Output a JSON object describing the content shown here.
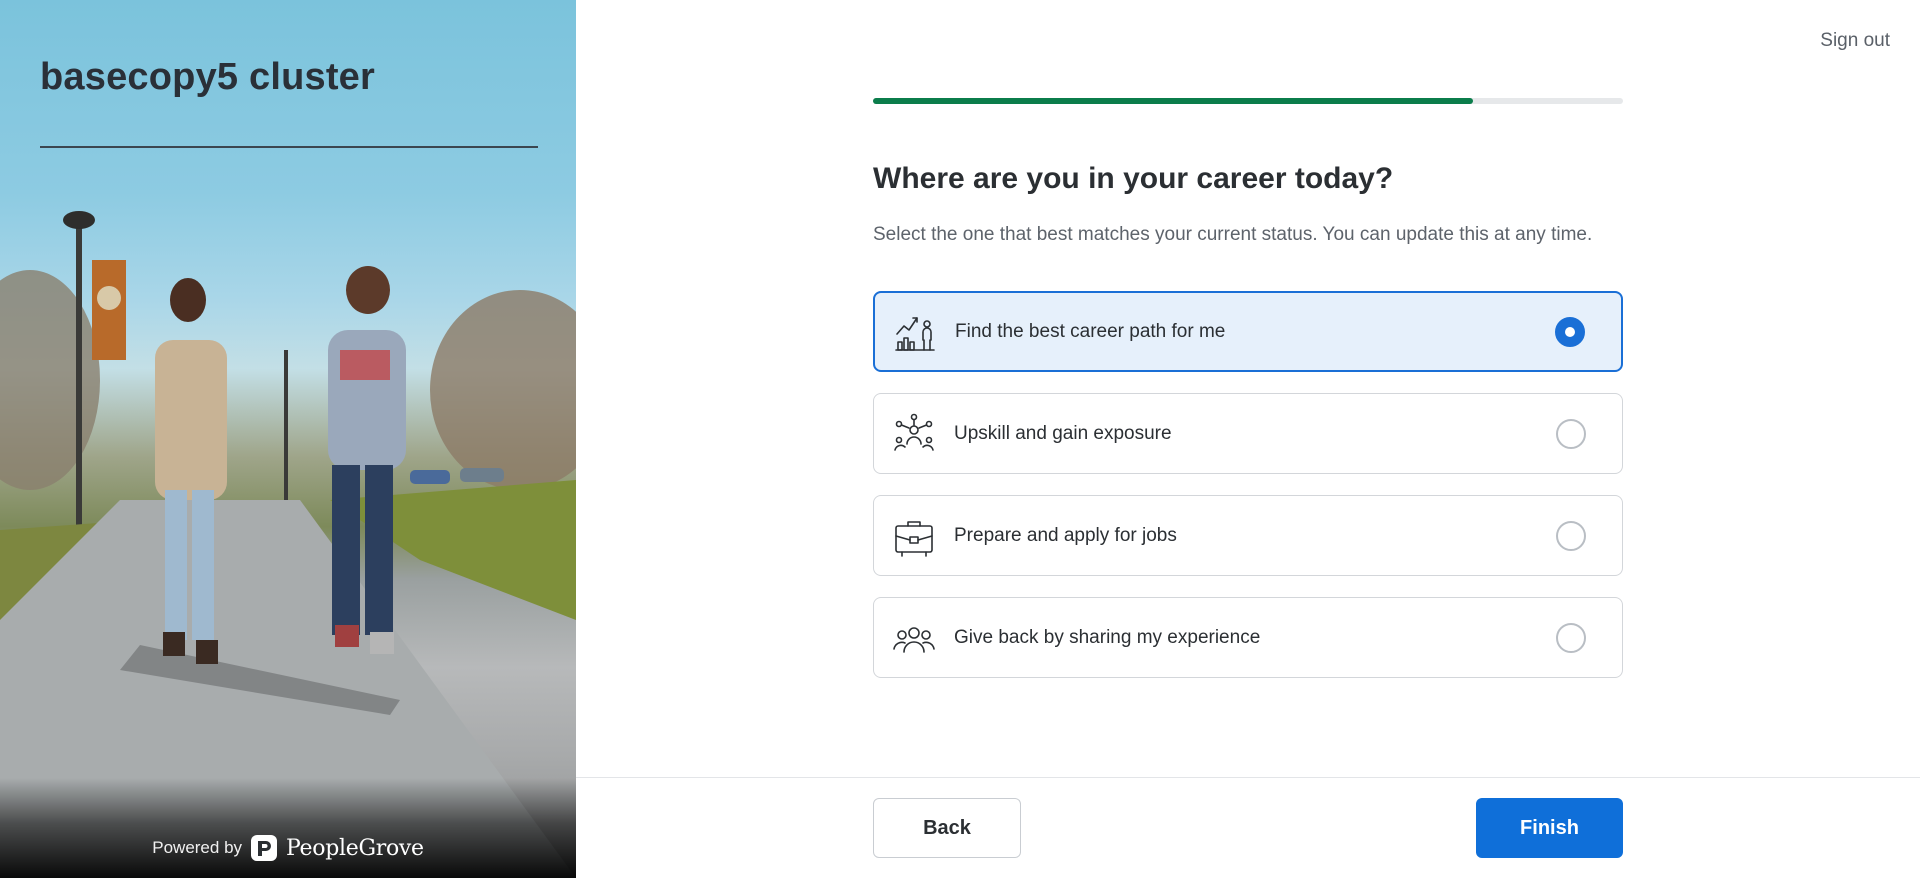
{
  "brand": {
    "title": "basecopy5 cluster",
    "powered_by": "Powered by",
    "platform_name": "PeopleGrove"
  },
  "header": {
    "signout_label": "Sign out"
  },
  "progress": {
    "value": 0.8,
    "color": "#0b7d4b"
  },
  "question": {
    "title": "Where are you in your career today?",
    "subtitle": "Select the one that best matches your current status. You can update this at any time."
  },
  "options": [
    {
      "label": "Find the best career path for me",
      "icon": "career-path-icon",
      "selected": true
    },
    {
      "label": "Upskill and gain exposure",
      "icon": "network-people-icon",
      "selected": false
    },
    {
      "label": "Prepare and apply for jobs",
      "icon": "briefcase-icon",
      "selected": false
    },
    {
      "label": "Give back by sharing my experience",
      "icon": "group-people-icon",
      "selected": false
    }
  ],
  "footer": {
    "back_label": "Back",
    "finish_label": "Finish"
  },
  "colors": {
    "accent": "#0f6fd9",
    "selected_bg": "#e6f0fb",
    "progress": "#0b7d4b"
  }
}
